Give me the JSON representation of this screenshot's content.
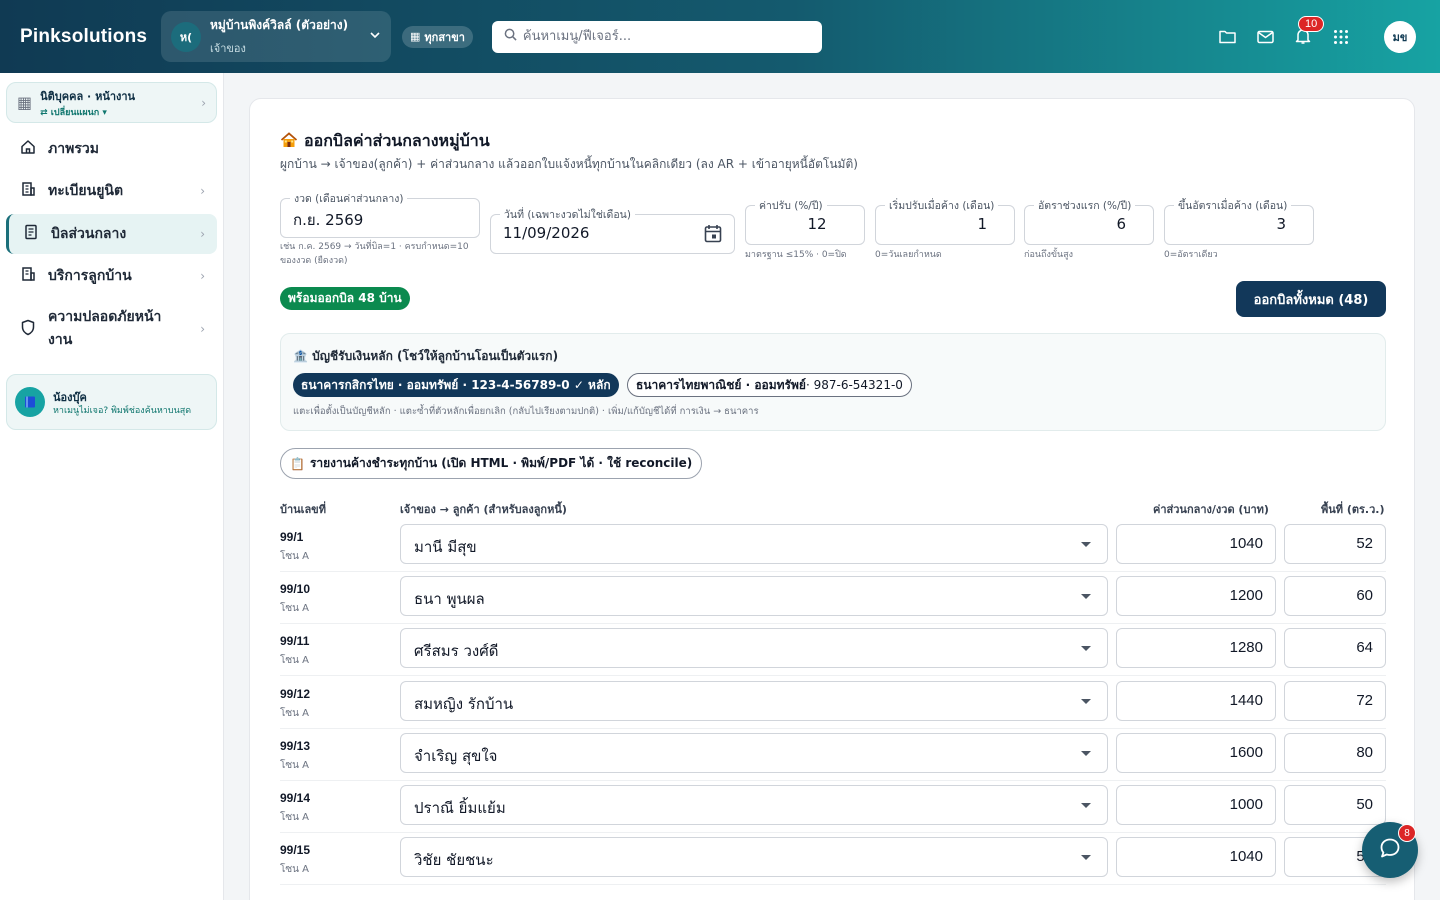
{
  "app": {
    "brand": "Pinksolutions",
    "org": {
      "avatar": "ห(",
      "name": "หมู่บ้านพิงค์วิลล์ (ตัวอย่าง)",
      "role": "เจ้าของ"
    },
    "branch": "ทุกสาขา",
    "search_placeholder": "ค้นหาเมนู/ฟีเจอร์...",
    "notifications": "10",
    "user_initials": "มข"
  },
  "sidebar": {
    "legal": {
      "title": "นิติบุคคล · หน้างาน",
      "sub": "⇄ เปลี่ยนแผนก ▾"
    },
    "items": [
      {
        "label": "ภาพรวม",
        "icon": "home-icon"
      },
      {
        "label": "ทะเบียนยูนิต",
        "icon": "building-icon"
      },
      {
        "label": "บิลส่วนกลาง",
        "icon": "receipt-icon"
      },
      {
        "label": "บริการลูกบ้าน",
        "icon": "service-icon"
      },
      {
        "label": "ความปลอดภัยหน้างาน",
        "icon": "shield-icon"
      }
    ],
    "helper": {
      "title": "น้องบุ๊ค",
      "sub": "หาเมนูไม่เจอ? พิมพ์ช่องค้นหาบนสุด"
    }
  },
  "page": {
    "title": "ออกบิลค่าส่วนกลางหมู่บ้าน",
    "subtitle": "ผูกบ้าน → เจ้าของ(ลูกค้า) + ค่าส่วนกลาง แล้วออกใบแจ้งหนี้ทุกบ้านในคลิกเดียว (ลง AR + เข้าอายุหนี้อัตโนมัติ)",
    "fields": {
      "period": {
        "label": "งวด (เดือนค่าส่วนกลาง)",
        "value": "ก.ย. 2569",
        "hint1": "เช่น ก.ค. 2569 → วันที่บิล=1 · ครบกำหนด=10",
        "hint2": "ของงวด (ยืดงวด)"
      },
      "date": {
        "label": "วันที่ (เฉพาะงวดไม่ใช่เดือน)",
        "value": "11/09/2026"
      },
      "penalty": {
        "label": "ค่าปรับ (%/ปี)",
        "value": "12",
        "hint": "มาตรฐาน ≤15% · 0=ปิด"
      },
      "start": {
        "label": "เริ่มปรับเมื่อค้าง (เดือน)",
        "value": "1",
        "hint": "0=วันเลยกำหนด"
      },
      "first_rate": {
        "label": "อัตราช่วงแรก (%/ปี)",
        "value": "6",
        "hint": "ก่อนถึงขั้นสูง"
      },
      "step_up": {
        "label": "ขึ้นอัตราเมื่อค้าง (เดือน)",
        "value": "3",
        "hint": "0=อัตราเดียว"
      }
    },
    "ready_badge": "พร้อมออกบิล 48 บ้าน",
    "issue_button": "ออกบิลทั้งหมด (48)",
    "bank": {
      "title": "บัญชีรับเงินหลัก (โชว์ให้ลูกบ้านโอนเป็นตัวแรก)",
      "primary": "ธนาคารกสิกรไทย · ออมทรัพย์ · 123-4-56789-0 ✓ หลัก",
      "secondary_bank": "ธนาคารไทยพาณิชย์ · ออมทรัพย์",
      "secondary_acct": " · 987-6-54321-0",
      "note": "แตะเพื่อตั้งเป็นบัญชีหลัก · แตะซ้ำที่ตัวหลักเพื่อยกเลิก (กลับไปเรียงตามปกติ) · เพิ่ม/แก้บัญชีได้ที่ การเงิน → ธนาคาร"
    },
    "report_button": "รายงานค้างชำระทุกบ้าน (เปิด HTML · พิมพ์/PDF ได้ · ใช้ reconcile)",
    "table": {
      "headers": {
        "house": "บ้านเลขที่",
        "owner": "เจ้าของ → ลูกค้า (สำหรับลงลูกหนี้)",
        "fee": "ค่าส่วนกลาง/งวด (บาท)",
        "area": "พื้นที่ (ตร.ว.)"
      },
      "rows": [
        {
          "house": "99/1",
          "zone": "โซน A",
          "owner": "มานี มีสุข",
          "fee": "1040",
          "area": "52"
        },
        {
          "house": "99/10",
          "zone": "โซน A",
          "owner": "ธนา พูนผล",
          "fee": "1200",
          "area": "60"
        },
        {
          "house": "99/11",
          "zone": "โซน A",
          "owner": "ศรีสมร วงศ์ดี",
          "fee": "1280",
          "area": "64"
        },
        {
          "house": "99/12",
          "zone": "โซน A",
          "owner": "สมหญิง รักบ้าน",
          "fee": "1440",
          "area": "72"
        },
        {
          "house": "99/13",
          "zone": "โซน A",
          "owner": "จำเริญ สุขใจ",
          "fee": "1600",
          "area": "80"
        },
        {
          "house": "99/14",
          "zone": "โซน A",
          "owner": "ปราณี ยิ้มแย้ม",
          "fee": "1000",
          "area": "50"
        },
        {
          "house": "99/15",
          "zone": "โซน A",
          "owner": "วิชัย ชัยชนะ",
          "fee": "1040",
          "area": "52"
        }
      ]
    }
  },
  "chat": {
    "badge": "8"
  },
  "colors": {
    "topbar_start": "#103a53",
    "topbar_end": "#17a3a3",
    "primary": "#12385a",
    "success": "#0b8a4f",
    "danger": "#dc2626"
  }
}
